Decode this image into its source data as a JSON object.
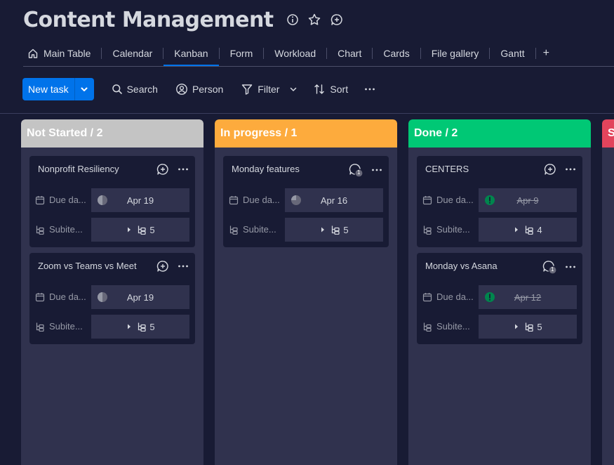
{
  "page": {
    "title": "Content Management"
  },
  "tabs": [
    {
      "label": "Main Table",
      "icon": "home-icon"
    },
    {
      "label": "Calendar"
    },
    {
      "label": "Kanban",
      "active": true
    },
    {
      "label": "Form"
    },
    {
      "label": "Workload"
    },
    {
      "label": "Chart"
    },
    {
      "label": "Cards"
    },
    {
      "label": "File gallery"
    },
    {
      "label": "Gantt"
    },
    {
      "label": "+"
    }
  ],
  "toolbar": {
    "new_task": "New task",
    "search": "Search",
    "person": "Person",
    "filter": "Filter",
    "sort": "Sort"
  },
  "colors": {
    "not_started": "#c4c4c4",
    "in_progress": "#fdab3d",
    "done": "#00c875",
    "stuck": "#e2445c",
    "accent": "#0073ea"
  },
  "columns": [
    {
      "title": "Not Started / 2",
      "cards": [
        {
          "title": "Nonprofit Resiliency",
          "due_label": "Due da...",
          "due_date": "Apr 19",
          "subitems_label": "Subite...",
          "subitems_count": "5"
        },
        {
          "title": "Zoom vs Teams vs Meet",
          "due_label": "Due da...",
          "due_date": "Apr 19",
          "subitems_label": "Subite...",
          "subitems_count": "5"
        }
      ]
    },
    {
      "title": "In progress / 1",
      "cards": [
        {
          "title": "Monday features",
          "due_label": "Due da...",
          "due_date": "Apr 16",
          "subitems_label": "Subite...",
          "subitems_count": "5",
          "update_count": "1"
        }
      ]
    },
    {
      "title": "Done / 2",
      "cards": [
        {
          "title": "CENTERS",
          "due_label": "Due da...",
          "due_date": "Apr 9",
          "subitems_label": "Subite...",
          "subitems_count": "4"
        },
        {
          "title": "Monday vs Asana",
          "due_label": "Due da...",
          "due_date": "Apr 12",
          "subitems_label": "Subite...",
          "subitems_count": "5",
          "update_count": "1"
        }
      ]
    },
    {
      "title": "S",
      "cards": []
    }
  ]
}
